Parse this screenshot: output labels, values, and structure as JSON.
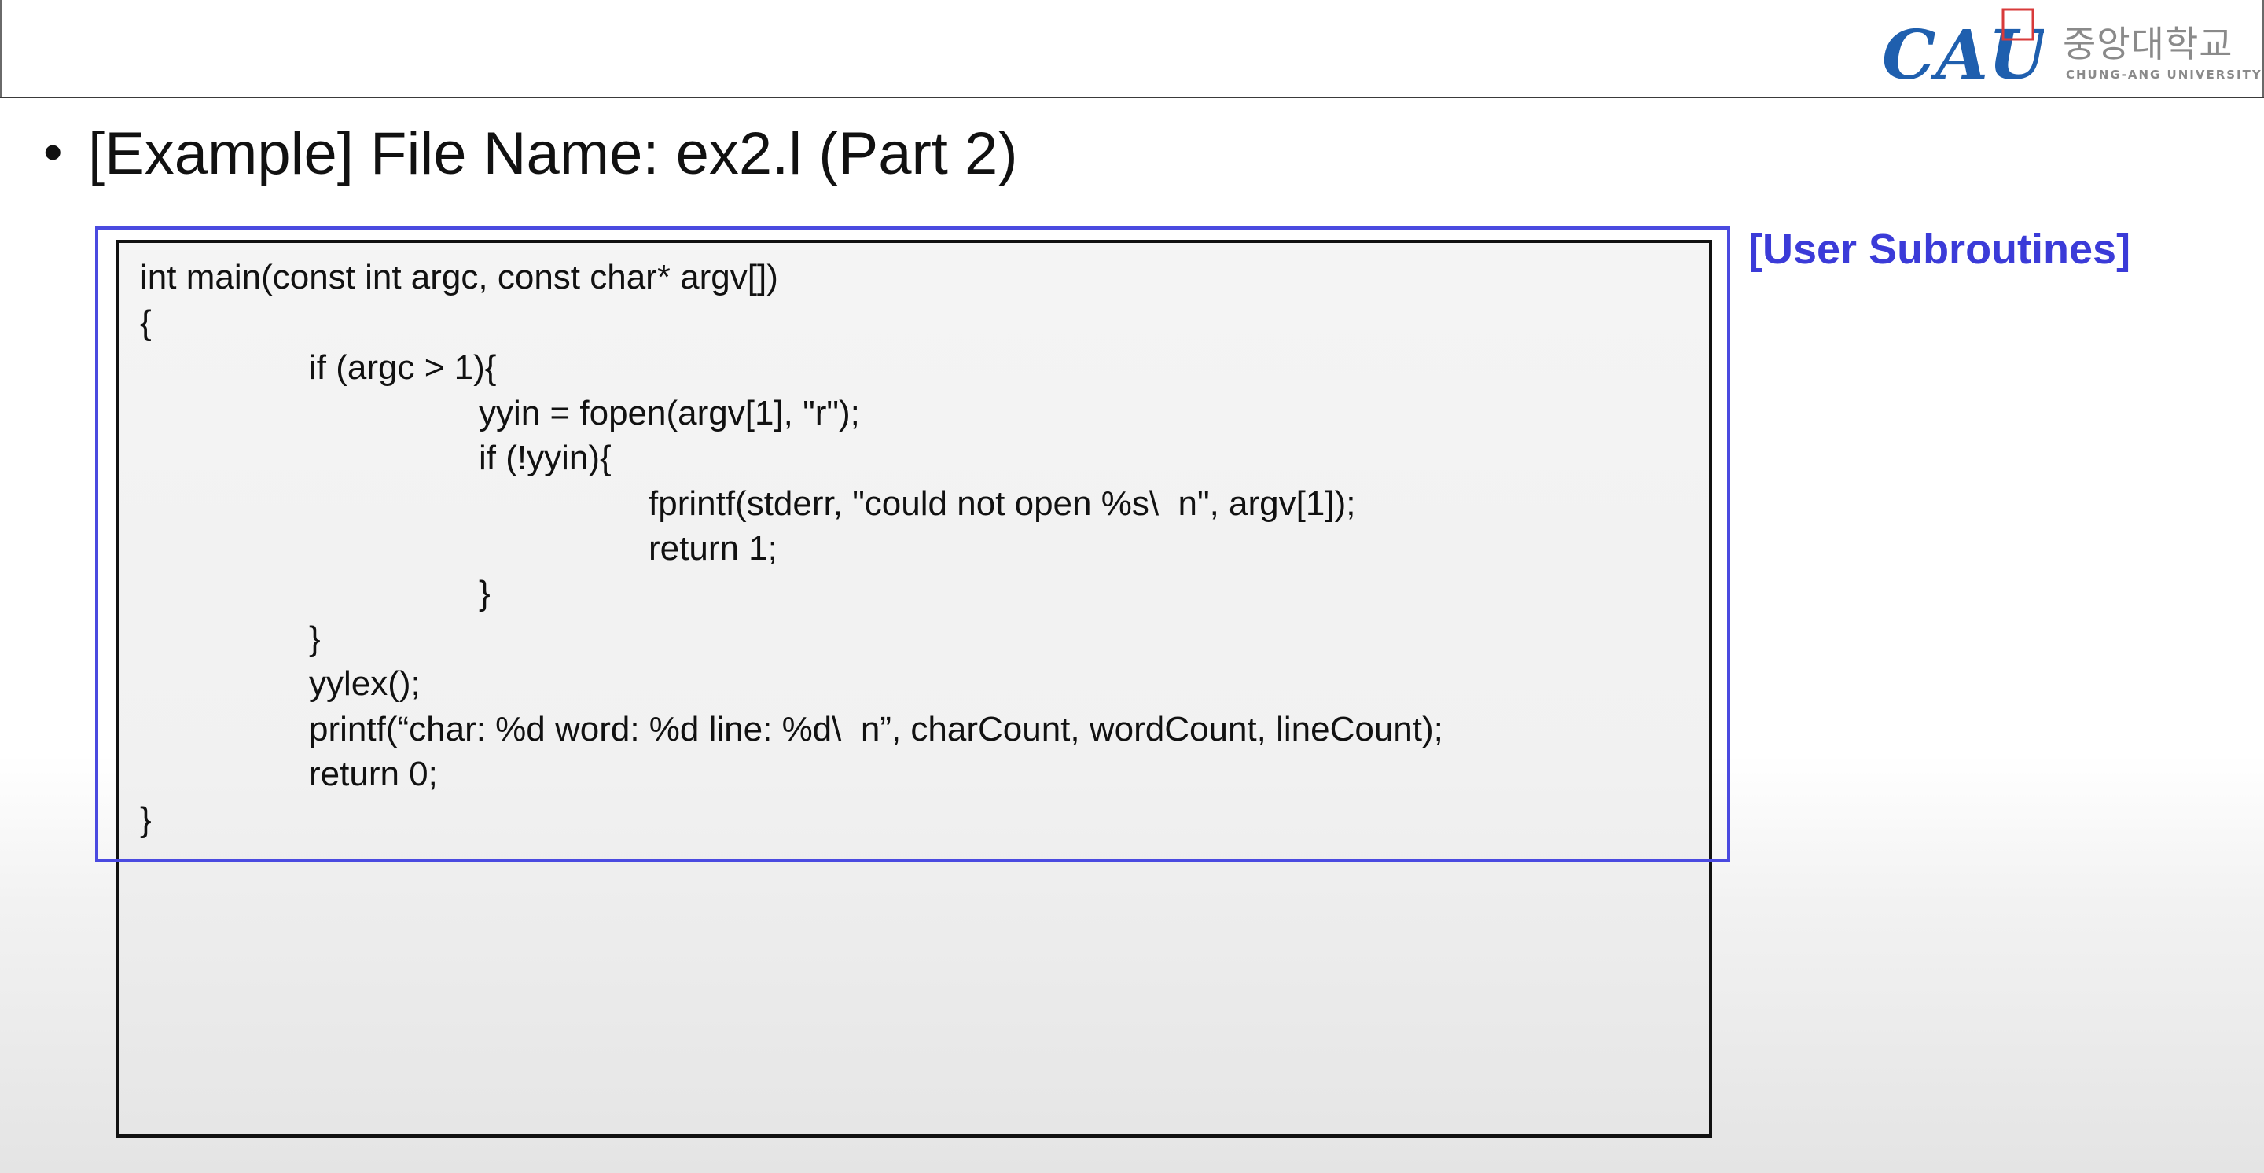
{
  "header": {
    "logo_mark_text": "CAU",
    "logo_korean": "중앙대학교",
    "logo_english": "CHUNG-ANG UNIVERSITY"
  },
  "slide": {
    "bullet": "•",
    "title": "[Example] File Name: ex2.l (Part 2)",
    "section_label": "[User Subroutines]"
  },
  "code_lines": [
    "int main(const int argc, const char* argv[])",
    "{",
    "if (argc > 1){",
    "yyin = fopen(argv[1], \"r\");",
    "if (!yyin){",
    "fprintf(stderr, \"could not open %s\\  n\", argv[1]);",
    "return 1;",
    "}",
    "}",
    "yylex();",
    "printf(“char: %d word: %d line: %d\\  n”, charCount, wordCount, lineCount);",
    "return 0;",
    "}"
  ],
  "colors": {
    "accent": "#3b3bd8",
    "logo_blue": "#1f5fae",
    "logo_red": "#d83a3a"
  }
}
